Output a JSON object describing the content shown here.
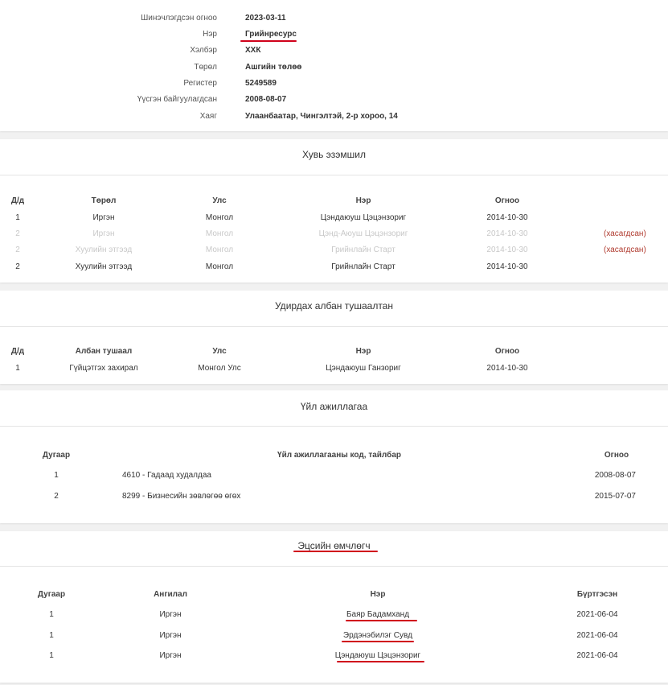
{
  "general": {
    "rows": [
      {
        "label": "Шинэчлэгдсэн огноо",
        "value": "2023-03-11"
      },
      {
        "label": "Нэр",
        "value": "Грийнресурс"
      },
      {
        "label": "Хэлбэр",
        "value": "ХХК"
      },
      {
        "label": "Төрөл",
        "value": "Ашгийн төлөө"
      },
      {
        "label": "Регистер",
        "value": "5249589"
      },
      {
        "label": "Үүсгэн байгуулагдсан",
        "value": "2008-08-07"
      },
      {
        "label": "Хаяг",
        "value": "Улаанбаатар, Чингэлтэй, 2-р хороо, 14"
      }
    ]
  },
  "shareholders": {
    "title": "Хувь эзэмшил",
    "headers": {
      "no": "Д/д",
      "type": "Төрөл",
      "country": "Улс",
      "name": "Нэр",
      "date": "Огноо"
    },
    "rows": [
      {
        "no": "1",
        "type": "Иргэн",
        "country": "Монгол",
        "name": "Цэндаюуш Цэцэнзориг",
        "date": "2014-10-30",
        "status": ""
      },
      {
        "no": "2",
        "type": "Иргэн",
        "country": "Монгол",
        "name": "Цэнд-Аюуш Цэцэнзориг",
        "date": "2014-10-30",
        "status": "(хасагдсан)"
      },
      {
        "no": "2",
        "type": "Хуулийн этгээд",
        "country": "Монгол",
        "name": "Грийнлайн Старт",
        "date": "2014-10-30",
        "status": "(хасагдсан)"
      },
      {
        "no": "2",
        "type": "Хуулийн этгээд",
        "country": "Монгол",
        "name": "Грийнлайн Старт",
        "date": "2014-10-30",
        "status": ""
      }
    ]
  },
  "officials": {
    "title": "Удирдах албан тушаалтан",
    "headers": {
      "no": "Д/д",
      "position": "Албан тушаал",
      "country": "Улс",
      "name": "Нэр",
      "date": "Огноо"
    },
    "rows": [
      {
        "no": "1",
        "position": "Гүйцэтгэх захирал",
        "country": "Монгол Улс",
        "name": "Цэндаюуш Ганзориг",
        "date": "2014-10-30"
      }
    ]
  },
  "activities": {
    "title": "Үйл ажиллагаа",
    "headers": {
      "no": "Дугаар",
      "code": "Үйл ажиллагааны код, тайлбар",
      "date": "Огноо"
    },
    "rows": [
      {
        "no": "1",
        "code": "4610 - Гадаад худалдаа",
        "date": "2008-08-07"
      },
      {
        "no": "2",
        "code": "8299 - Бизнесийн зөвлөгөө өгөх",
        "date": "2015-07-07"
      }
    ]
  },
  "beneficiaries": {
    "title": "Эцсийн өмчлөгч",
    "headers": {
      "no": "Дугаар",
      "category": "Ангилал",
      "name": "Нэр",
      "registered": "Бүртгэсэн"
    },
    "rows": [
      {
        "no": "1",
        "category": "Иргэн",
        "name": "Баяр Бадамханд",
        "registered": "2021-06-04"
      },
      {
        "no": "1",
        "category": "Иргэн",
        "name": "Эрдэнэбилэг Сувд",
        "registered": "2021-06-04"
      },
      {
        "no": "1",
        "category": "Иргэн",
        "name": "Цэндаюуш Цэцэнзориг",
        "registered": "2021-06-04"
      }
    ]
  },
  "colors": {
    "highlight": "#d0021b",
    "removed": "#b03a2e"
  }
}
